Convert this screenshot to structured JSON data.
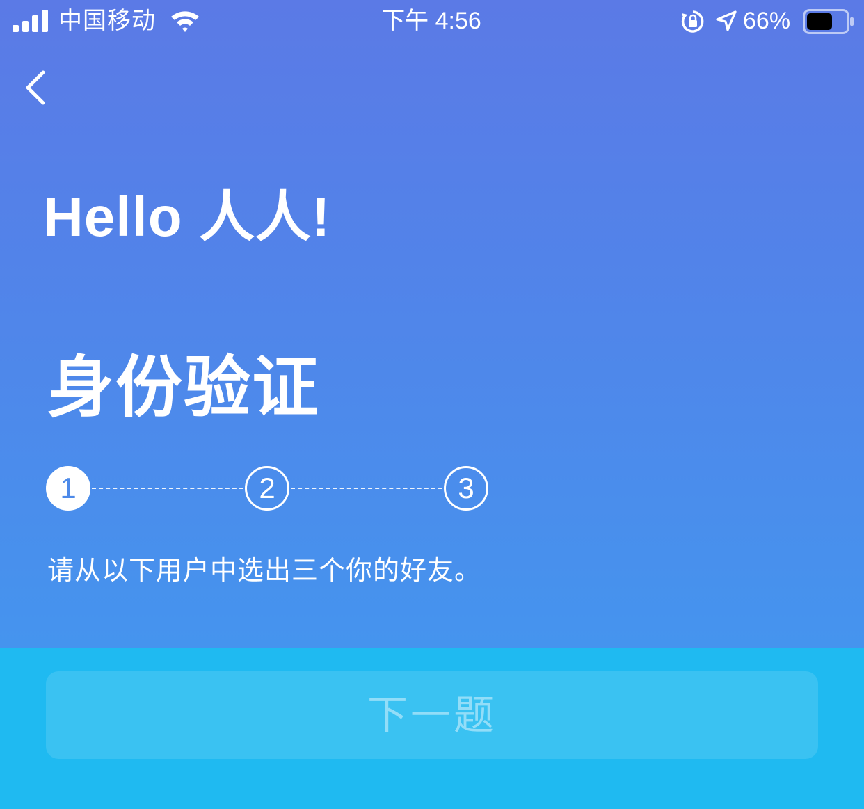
{
  "status_bar": {
    "carrier": "中国移动",
    "time": "下午 4:56",
    "battery_percent": "66%",
    "battery_level": 0.66,
    "icons": [
      "signal-bars-icon",
      "wifi-icon",
      "orientation-lock-icon",
      "location-arrow-icon",
      "battery-icon"
    ]
  },
  "nav": {
    "back_icon": "chevron-left-icon"
  },
  "header": {
    "greeting": "Hello 人人!"
  },
  "main": {
    "title": "身份验证",
    "steps": [
      {
        "label": "1",
        "active": true
      },
      {
        "label": "2",
        "active": false
      },
      {
        "label": "3",
        "active": false
      }
    ],
    "instruction": "请从以下用户中选出三个你的好友。"
  },
  "footer": {
    "next_button_label": "下一题"
  },
  "colors": {
    "gradient_top": "#5b7ae6",
    "gradient_bottom": "#4594ee",
    "footer_bg": "#1fbaf1",
    "text": "#ffffff"
  }
}
